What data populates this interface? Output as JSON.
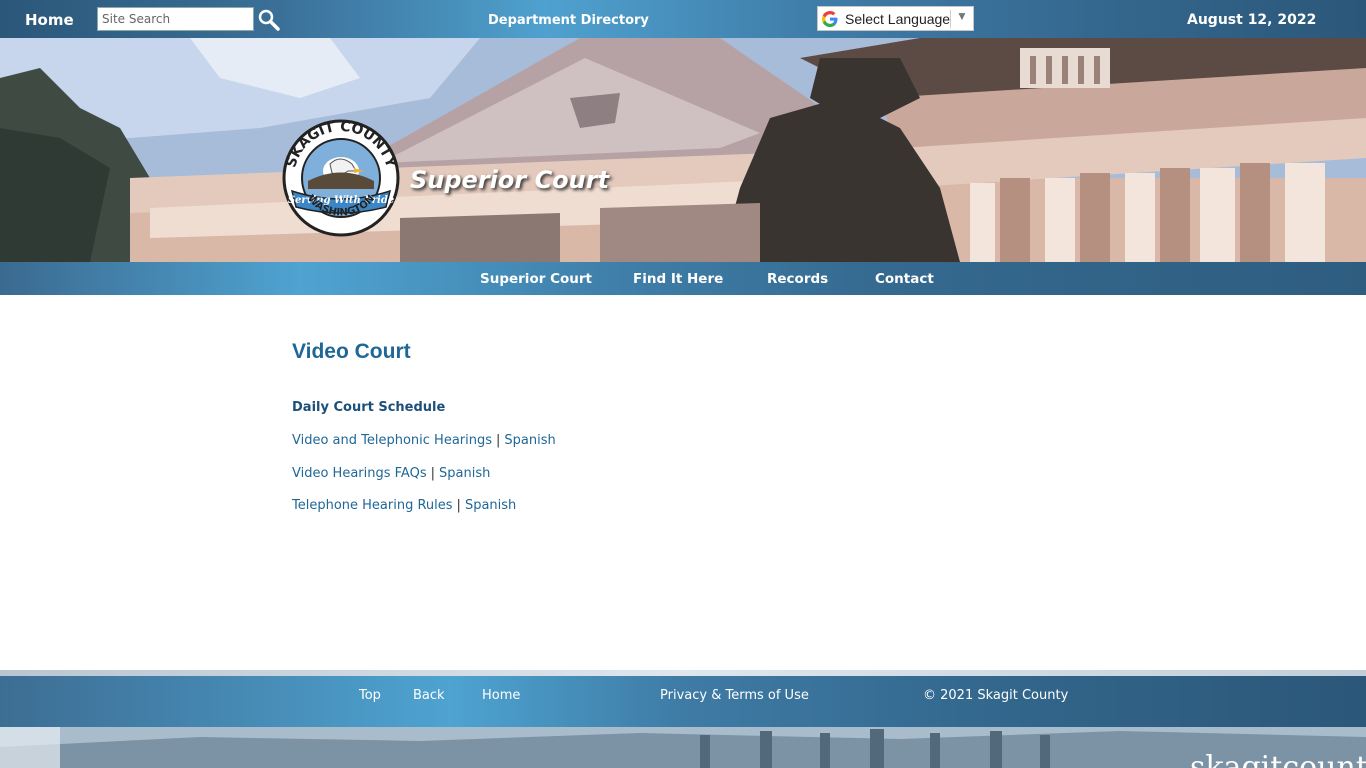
{
  "topbar": {
    "home": "Home",
    "search_placeholder": "Site Search",
    "department_directory": "Department Directory",
    "language_label": "Select Language",
    "date": "August 12, 2022"
  },
  "banner": {
    "title": "Superior Court",
    "seal_text_top": "SKAGIT COUNTY",
    "seal_text_ribbon": "Serving With Pride",
    "seal_text_bottom": "WASHINGTON"
  },
  "nav": {
    "items": [
      "Superior Court",
      "Find It Here",
      "Records",
      "Contact"
    ]
  },
  "main": {
    "heading": "Video Court",
    "schedule": "Daily Court Schedule",
    "rows": [
      {
        "link": "Video and Telephonic Hearings",
        "alt": "Spanish"
      },
      {
        "link": "Video Hearings FAQs",
        "alt": "Spanish"
      },
      {
        "link": "Telephone Hearing Rules",
        "alt": "Spanish"
      }
    ],
    "separator": "|"
  },
  "footer": {
    "top": "Top",
    "back": "Back",
    "home": "Home",
    "privacy": "Privacy & Terms of Use",
    "copyright": "© 2021 Skagit County"
  },
  "watermark": "skagitcounty"
}
